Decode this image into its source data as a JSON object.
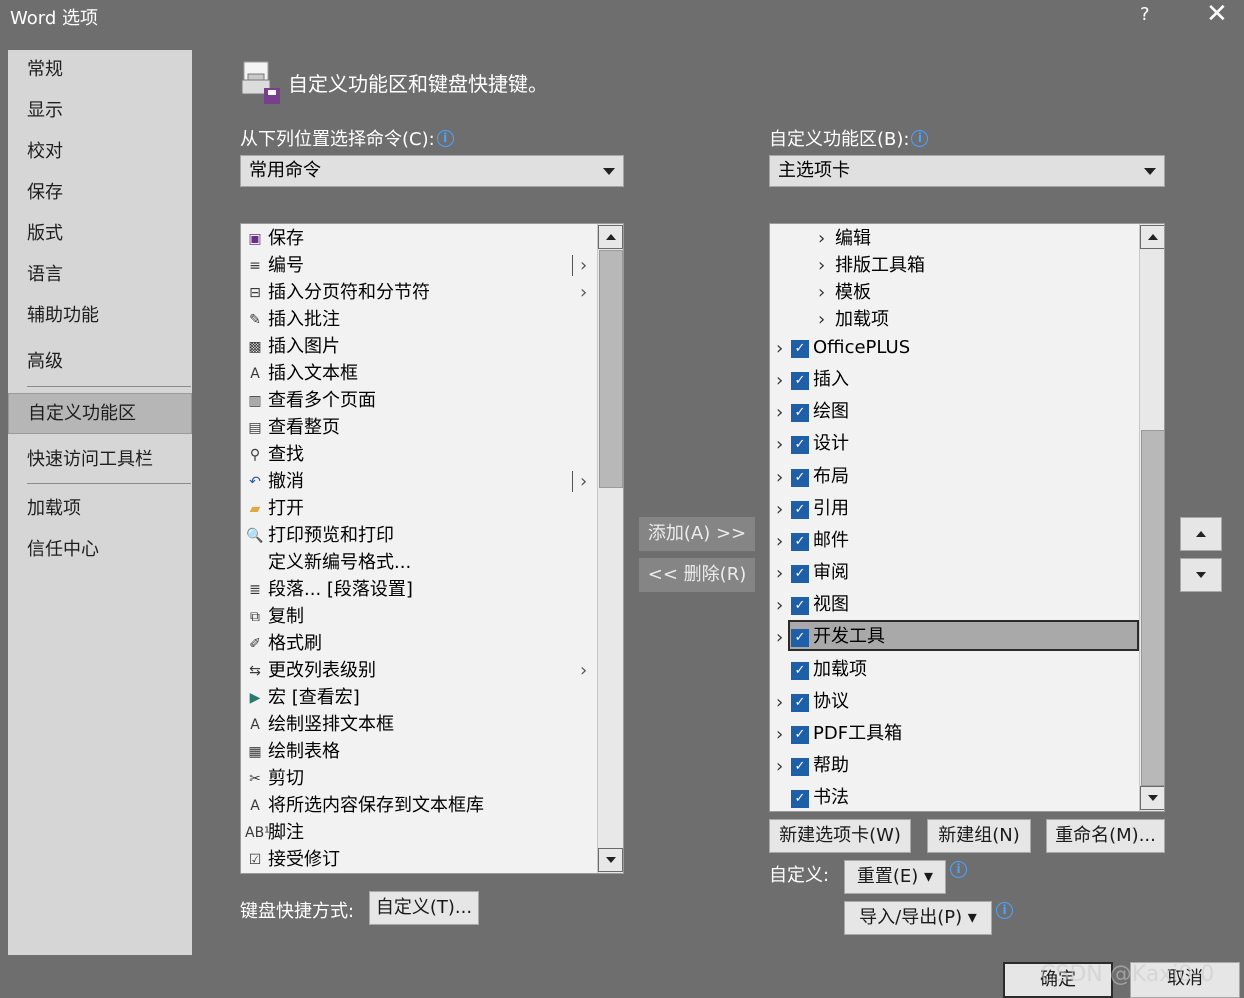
{
  "window": {
    "title": "Word 选项",
    "help": "?",
    "close": "✕"
  },
  "nav": {
    "items": [
      "常规",
      "显示",
      "校对",
      "保存",
      "版式",
      "语言",
      "辅助功能",
      "高级",
      "自定义功能区",
      "快速访问工具栏",
      "加载项",
      "信任中心"
    ]
  },
  "header": {
    "title": "自定义功能区和键盘快捷键。"
  },
  "left": {
    "choose_label": "从下列位置选择命令(C):",
    "choose_value": "常用命令",
    "commands": [
      {
        "label": "保存",
        "icon": "save-icon",
        "glyph": "▣"
      },
      {
        "label": "编号",
        "icon": "numbering-icon",
        "glyph": "≡",
        "sub": true,
        "pipe": true
      },
      {
        "label": "插入分页符和分节符",
        "icon": "page-break-icon",
        "glyph": "⊟",
        "sub": true
      },
      {
        "label": "插入批注",
        "icon": "comment-icon",
        "glyph": "✎"
      },
      {
        "label": "插入图片",
        "icon": "picture-icon",
        "glyph": "▩"
      },
      {
        "label": "插入文本框",
        "icon": "textbox-icon",
        "glyph": "A"
      },
      {
        "label": "查看多个页面",
        "icon": "multi-page-icon",
        "glyph": "▥"
      },
      {
        "label": "查看整页",
        "icon": "one-page-icon",
        "glyph": "▤"
      },
      {
        "label": "查找",
        "icon": "find-icon",
        "glyph": "⚲"
      },
      {
        "label": "撤消",
        "icon": "undo-icon",
        "glyph": "↶",
        "sub": true,
        "pipe": true
      },
      {
        "label": "打开",
        "icon": "open-folder-icon",
        "glyph": "▰"
      },
      {
        "label": "打印预览和打印",
        "icon": "print-preview-icon",
        "glyph": "🔍"
      },
      {
        "label": "定义新编号格式...",
        "icon": "",
        "glyph": ""
      },
      {
        "label": "段落... [段落设置]",
        "icon": "paragraph-icon",
        "glyph": "≣"
      },
      {
        "label": "复制",
        "icon": "copy-icon",
        "glyph": "⧉"
      },
      {
        "label": "格式刷",
        "icon": "format-painter-icon",
        "glyph": "✐"
      },
      {
        "label": "更改列表级别",
        "icon": "list-level-icon",
        "glyph": "⇆",
        "sub": true
      },
      {
        "label": "宏 [查看宏]",
        "icon": "macro-icon",
        "glyph": "▶"
      },
      {
        "label": "绘制竖排文本框",
        "icon": "vertical-textbox-icon",
        "glyph": "A"
      },
      {
        "label": "绘制表格",
        "icon": "draw-table-icon",
        "glyph": "▦"
      },
      {
        "label": "剪切",
        "icon": "cut-icon",
        "glyph": "✂"
      },
      {
        "label": "将所选内容保存到文本框库",
        "icon": "save-selection-icon",
        "glyph": "A"
      },
      {
        "label": "脚注",
        "icon": "footnote-icon",
        "glyph": "AB¹"
      },
      {
        "label": "接受修订",
        "icon": "accept-changes-icon",
        "glyph": "☑"
      }
    ],
    "shortcut_label": "键盘快捷方式:",
    "shortcut_button": "自定义(T)..."
  },
  "middle": {
    "add_button": "添加(A) >>",
    "remove_button": "<< 删除(R)"
  },
  "right": {
    "ribbon_label": "自定义功能区(B):",
    "ribbon_value": "主选项卡",
    "sub_groups": [
      "编辑",
      "排版工具箱",
      "模板",
      "加载项"
    ],
    "tabs": [
      {
        "label": "OfficePLUS",
        "expand": true
      },
      {
        "label": "插入",
        "expand": true
      },
      {
        "label": "绘图",
        "expand": true
      },
      {
        "label": "设计",
        "expand": true
      },
      {
        "label": "布局",
        "expand": true
      },
      {
        "label": "引用",
        "expand": true
      },
      {
        "label": "邮件",
        "expand": true
      },
      {
        "label": "审阅",
        "expand": true
      },
      {
        "label": "视图",
        "expand": true
      },
      {
        "label": "开发工具",
        "expand": true,
        "selected": true
      },
      {
        "label": "加载项",
        "expand": false
      },
      {
        "label": "协议",
        "expand": true
      },
      {
        "label": "PDF工具箱",
        "expand": true
      },
      {
        "label": "帮助",
        "expand": true
      },
      {
        "label": "书法",
        "expand": false
      }
    ],
    "new_tab": "新建选项卡(W)",
    "new_group": "新建组(N)",
    "rename": "重命名(M)...",
    "customize_label": "自定义:",
    "reset": "重置(E) ▾",
    "import_export": "导入/导出(P) ▾"
  },
  "footer": {
    "ok": "确定",
    "cancel": "取消",
    "watermark": "CSDN @Kaxi0-0"
  },
  "colors": {
    "background": "#6e6e6e",
    "nav": "#d6d6d6",
    "checkbox": "#1f5fa8",
    "info": "#4aa3ff"
  }
}
